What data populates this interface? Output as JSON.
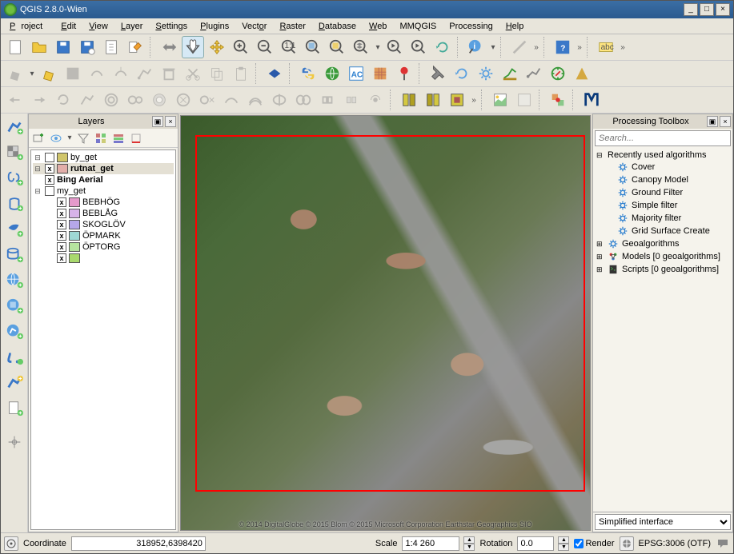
{
  "window": {
    "title": "QGIS 2.8.0-Wien"
  },
  "menu": [
    "Project",
    "Edit",
    "View",
    "Layer",
    "Settings",
    "Plugins",
    "Vector",
    "Raster",
    "Database",
    "Web",
    "MMQGIS",
    "Processing",
    "Help"
  ],
  "panels": {
    "layers_title": "Layers",
    "processing_title": "Processing Toolbox"
  },
  "search": {
    "placeholder": "Search..."
  },
  "layers": {
    "items": [
      {
        "id": "by_get",
        "label": "by_get",
        "checked": false,
        "children": false,
        "swatch": "#d0c56b",
        "exp": "⊟"
      },
      {
        "id": "rutnat_get",
        "label": "rutnat_get",
        "checked": true,
        "bold": true,
        "selected": true,
        "swatch": "#e2aea9",
        "exp": "⊟"
      },
      {
        "id": "bing",
        "label": "Bing Aerial",
        "checked": true,
        "bold": true
      },
      {
        "id": "my_get",
        "label": "my_get",
        "checked": false,
        "children": true,
        "exp": "⊟"
      }
    ],
    "my_get_children": [
      {
        "label": "BEBHÖG",
        "swatch": "#e59acb",
        "checked": true
      },
      {
        "label": "BEBLÅG",
        "swatch": "#d7b3e8",
        "checked": true
      },
      {
        "label": "SKOGLÖV",
        "swatch": "#b6a7ea",
        "checked": true
      },
      {
        "label": "ÖPMARK",
        "swatch": "#9fd7d4",
        "checked": true
      },
      {
        "label": "ÖPTORG",
        "swatch": "#b6e39f",
        "checked": true
      },
      {
        "label": "",
        "swatch": "#a9d96d",
        "checked": true
      }
    ]
  },
  "processing": {
    "recent_label": "Recently used algorithms",
    "recent": [
      "Cover",
      "Canopy Model",
      "Ground Filter",
      "Simple filter",
      "Majority filter",
      "Grid Surface Create"
    ],
    "groups": [
      {
        "label": "Geoalgorithms",
        "icon": "gear"
      },
      {
        "label": "Models [0 geoalgorithms]",
        "icon": "models"
      },
      {
        "label": "Scripts [0 geoalgorithms]",
        "icon": "scripts"
      }
    ],
    "interface_label": "Simplified interface"
  },
  "status": {
    "coord_label": "Coordinate",
    "coord_value": "318952,6398420",
    "scale_label": "Scale",
    "scale_value": "1:4 260",
    "rotation_label": "Rotation",
    "rotation_value": "0.0",
    "render_label": "Render",
    "epsg_label": "EPSG:3006 (OTF)"
  },
  "map": {
    "credit": "© 2014 DigitalGlobe © 2015 Blom © 2015 Microsoft Corporation   Earthstar Geographics SIO"
  }
}
